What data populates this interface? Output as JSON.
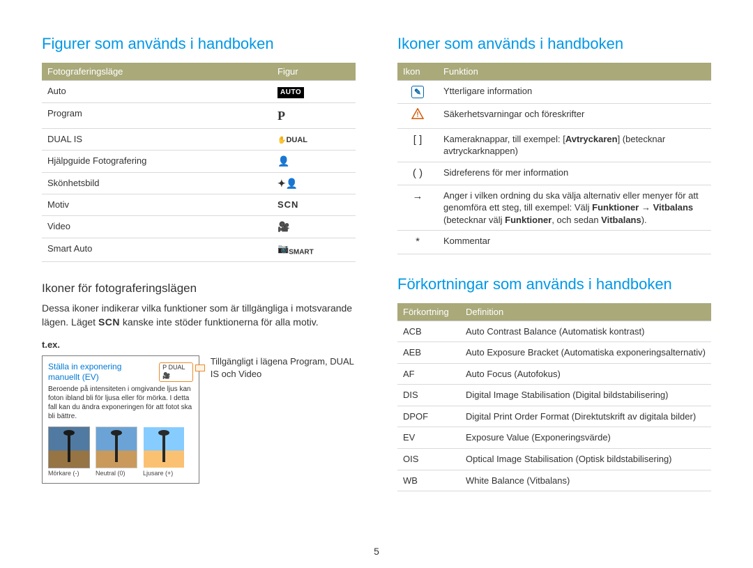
{
  "page_number": "5",
  "left": {
    "heading": "Figurer som används i handboken",
    "mode_table": {
      "headers": [
        "Fotograferingsläge",
        "Figur"
      ],
      "rows": [
        {
          "mode": "Auto",
          "figure": "AUTO",
          "icon": "auto"
        },
        {
          "mode": "Program",
          "figure": "P",
          "icon": "p"
        },
        {
          "mode": "DUAL IS",
          "figure": "DUAL",
          "icon": "dual"
        },
        {
          "mode": "Hjälpguide Fotografering",
          "figure": "",
          "icon": "guide"
        },
        {
          "mode": "Skönhetsbild",
          "figure": "",
          "icon": "beauty"
        },
        {
          "mode": "Motiv",
          "figure": "SCN",
          "icon": "scn"
        },
        {
          "mode": "Video",
          "figure": "",
          "icon": "video"
        },
        {
          "mode": "Smart Auto",
          "figure": "SMART",
          "icon": "smart"
        }
      ]
    },
    "sub": {
      "heading": "Ikoner för fotograferingslägen",
      "para_a": "Dessa ikoner indikerar vilka funktioner som är tillgängliga i motsvarande lägen. Läget ",
      "scn": "SCN",
      "para_b": " kanske inte stöder funktionerna för alla motiv.",
      "tex": "t.ex.",
      "ex_title": "Ställa in exponering manuellt (EV)",
      "ex_badge": "P DUAL",
      "ex_desc": "Beroende på intensiteten i omgivande ljus kan foton ibland bli för ljusa eller för mörka. I detta fall kan du ändra exponeringen för att fotot ska bli bättre.",
      "thumbs": [
        "Mörkare (-)",
        "Neutral (0)",
        "Ljusare (+)"
      ],
      "side": "Tillgängligt i lägena Program, DUAL IS och Video"
    }
  },
  "right": {
    "heading_icons": "Ikoner som används i handboken",
    "icon_table": {
      "headers": [
        "Ikon",
        "Funktion"
      ],
      "rows": [
        {
          "icon": "info",
          "glyph": "✎",
          "text": "Ytterligare information"
        },
        {
          "icon": "warn",
          "glyph": "!",
          "text": "Säkerhetsvarningar och föreskrifter"
        },
        {
          "icon": "brackets",
          "glyph": "[ ]",
          "text_pre": "Kameraknappar, till exempel: [",
          "bold1": "Avtryckaren",
          "text_post": "] (betecknar avtryckarknappen)"
        },
        {
          "icon": "paren",
          "glyph": "( )",
          "text": "Sidreferens för mer information"
        },
        {
          "icon": "arrow",
          "glyph": "→",
          "text_a": "Anger i vilken ordning du ska välja alternativ eller menyer för att genomföra ett steg, till exempel: Välj ",
          "bold1": "Funktioner",
          "arrow": " → ",
          "bold2": "Vitbalans",
          "text_b": " (betecknar välj ",
          "bold3": "Funktioner",
          "text_c": ", och sedan ",
          "bold4": "Vitbalans",
          "text_d": ")."
        },
        {
          "icon": "star",
          "glyph": "*",
          "text": "Kommentar"
        }
      ]
    },
    "heading_abbr": "Förkortningar som används i handboken",
    "abbr_table": {
      "headers": [
        "Förkortning",
        "Definition"
      ],
      "rows": [
        {
          "abbr": "ACB",
          "def": "Auto Contrast Balance (Automatisk kontrast)"
        },
        {
          "abbr": "AEB",
          "def": "Auto Exposure Bracket (Automatiska exponeringsalternativ)"
        },
        {
          "abbr": "AF",
          "def": "Auto Focus (Autofokus)"
        },
        {
          "abbr": "DIS",
          "def": "Digital Image Stabilisation (Digital bildstabilisering)"
        },
        {
          "abbr": "DPOF",
          "def": "Digital Print Order Format (Direktutskrift av digitala bilder)"
        },
        {
          "abbr": "EV",
          "def": "Exposure Value (Exponeringsvärde)"
        },
        {
          "abbr": "OIS",
          "def": "Optical Image Stabilisation (Optisk bildstabilisering)"
        },
        {
          "abbr": "WB",
          "def": "White Balance (Vitbalans)"
        }
      ]
    }
  }
}
